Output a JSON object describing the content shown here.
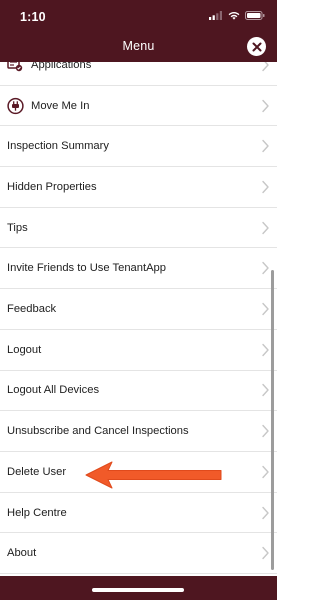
{
  "status_bar": {
    "time": "1:10"
  },
  "header": {
    "title": "Menu"
  },
  "menu": {
    "items": [
      {
        "label": "Applications"
      },
      {
        "label": "Move Me In"
      },
      {
        "label": "Inspection Summary"
      },
      {
        "label": "Hidden Properties"
      },
      {
        "label": "Tips"
      },
      {
        "label": "Invite Friends to Use TenantApp"
      },
      {
        "label": "Feedback"
      },
      {
        "label": "Logout"
      },
      {
        "label": "Logout All Devices"
      },
      {
        "label": "Unsubscribe and Cancel Inspections"
      },
      {
        "label": "Delete User"
      },
      {
        "label": "Help Centre"
      },
      {
        "label": "About"
      }
    ]
  },
  "icons": {
    "status": [
      "signal-icon",
      "wifi-icon",
      "battery-icon"
    ],
    "header": "close-icon",
    "menu_item_icons": [
      "applications-icon",
      "plug-icon"
    ],
    "row": "chevron-right-icon",
    "annotation": "arrow-left-icon"
  },
  "colors": {
    "brand": "#4e1620",
    "annotation_arrow": "#f15a29",
    "text": "#1e1e1e",
    "divider": "#e4e4e4",
    "chevron": "#c7c7c7"
  }
}
